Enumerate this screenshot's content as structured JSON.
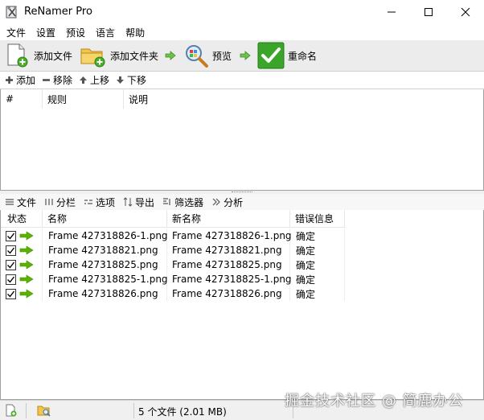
{
  "window": {
    "title": "ReNamer Pro"
  },
  "menu": [
    "文件",
    "设置",
    "预设",
    "语言",
    "帮助"
  ],
  "toolbar": {
    "add_files": "添加文件",
    "add_folder": "添加文件夹",
    "preview": "预览",
    "rename": "重命名"
  },
  "rules_toolbar": {
    "add": "添加",
    "remove": "移除",
    "up": "上移",
    "down": "下移"
  },
  "rules_table": {
    "columns": [
      "#",
      "规则",
      "说明"
    ],
    "rows": []
  },
  "files_toolbar": {
    "files": "文件",
    "columns": "分栏",
    "options": "选项",
    "export": "导出",
    "filters": "筛选器",
    "analyze": "分析"
  },
  "files_table": {
    "columns": [
      "状态",
      "名称",
      "新名称",
      "错误信息"
    ],
    "rows": [
      {
        "checked": true,
        "name": "Frame 427318826-1.png",
        "new_name": "Frame 427318826-1.png",
        "error": "确定"
      },
      {
        "checked": true,
        "name": "Frame 427318821.png",
        "new_name": "Frame 427318821.png",
        "error": "确定"
      },
      {
        "checked": true,
        "name": "Frame 427318825.png",
        "new_name": "Frame 427318825.png",
        "error": "确定"
      },
      {
        "checked": true,
        "name": "Frame 427318825-1.png",
        "new_name": "Frame 427318825-1.png",
        "error": "确定"
      },
      {
        "checked": true,
        "name": "Frame 427318826.png",
        "new_name": "Frame 427318826.png",
        "error": "确定"
      }
    ]
  },
  "status": {
    "summary": "5 个文件 (2.01 MB)"
  },
  "watermark": "掘金技术社区 @ 简鹿办公",
  "colors": {
    "arrow_green": "#5bb300",
    "rename_green": "#3aa52a",
    "toolbar_bg": "#ececec"
  }
}
